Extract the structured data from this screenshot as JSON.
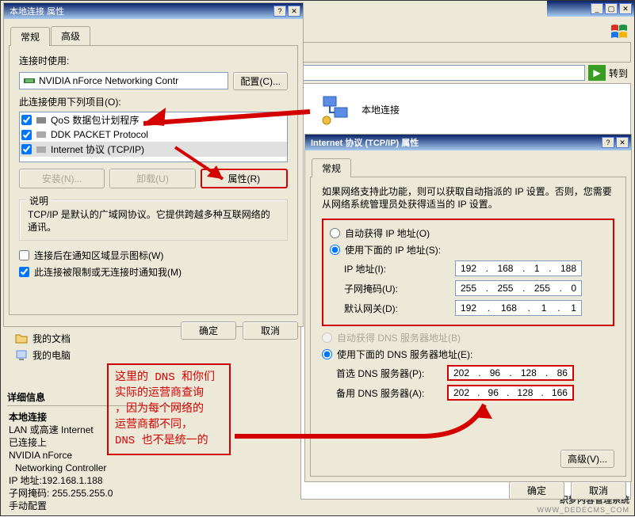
{
  "outer": {
    "address_go": "转到",
    "network_icon_label": "本地连接",
    "sidebar": {
      "mydocs": "我的文档",
      "mycomp": "我的电脑"
    },
    "details_header": "详细信息",
    "details": {
      "name": "本地连接",
      "type": "LAN 或高速 Internet",
      "status": "已连接上",
      "device1": "NVIDIA nForce",
      "device2": "Networking Controller",
      "ip_lbl": "IP 地址:192.168.1.188",
      "mask_lbl": "子网掩码: 255.255.255.0",
      "assign": "手动配置"
    },
    "footer_brand": "织梦内容管理系统",
    "footer_url": "WWW_DEDECMS_COM"
  },
  "props1": {
    "title": "本地连接 属性",
    "tabs": {
      "general": "常规",
      "advanced": "高级"
    },
    "connect_using": "连接时使用:",
    "adapter": "NVIDIA nForce Networking Contr",
    "configure": "配置(C)...",
    "items_label": "此连接使用下列项目(O):",
    "items": [
      {
        "label": "QoS 数据包计划程序"
      },
      {
        "label": "DDK PACKET Protocol"
      },
      {
        "label": "Internet 协议 (TCP/IP)"
      }
    ],
    "install": "安装(N)...",
    "uninstall": "卸载(U)",
    "properties": "属性(R)",
    "desc_header": "说明",
    "desc": "TCP/IP 是默认的广域网协议。它提供跨越多种互联网络的通讯。",
    "notify": "连接后在通知区域显示图标(W)",
    "limited": "此连接被限制或无连接时通知我(M)",
    "ok": "确定",
    "cancel": "取消"
  },
  "props2": {
    "title": "Internet 协议 (TCP/IP) 属性",
    "tab": "常规",
    "intro": "如果网络支持此功能，则可以获取自动指派的 IP 设置。否则，您需要从网络系统管理员处获得适当的 IP 设置。",
    "auto_ip": "自动获得 IP 地址(O)",
    "manual_ip": "使用下面的 IP 地址(S):",
    "ip_label": "IP 地址(I):",
    "ip": [
      "192",
      "168",
      "1",
      "188"
    ],
    "mask_label": "子网掩码(U):",
    "mask": [
      "255",
      "255",
      "255",
      "0"
    ],
    "gw_label": "默认网关(D):",
    "gw": [
      "192",
      "168",
      "1",
      "1"
    ],
    "auto_dns": "自动获得 DNS 服务器地址(B)",
    "manual_dns": "使用下面的 DNS 服务器地址(E):",
    "dns1_label": "首选 DNS 服务器(P):",
    "dns1": [
      "202",
      "96",
      "128",
      "86"
    ],
    "dns2_label": "备用 DNS 服务器(A):",
    "dns2": [
      "202",
      "96",
      "128",
      "166"
    ],
    "advanced": "高级(V)...",
    "ok": "确定",
    "cancel": "取消"
  },
  "annotation": {
    "l1": "这里的 DNS 和你们",
    "l2": "实际的运营商查询",
    "l3": "，因为每个网络的",
    "l4": "运营商都不同，",
    "l5": "DNS 也不是统一的"
  }
}
